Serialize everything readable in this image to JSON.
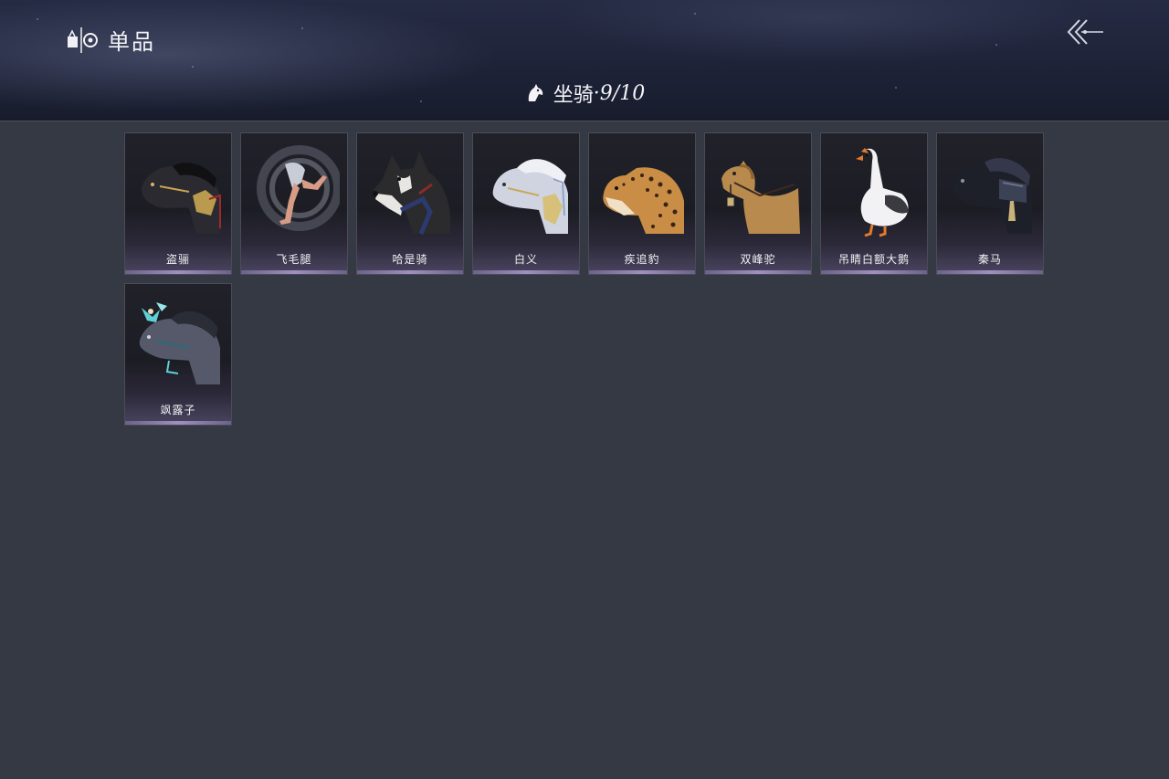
{
  "header": {
    "title": "单品",
    "title_icon": "tag-emblem-icon",
    "back_icon": "double-chevron-left-icon",
    "subtitle_label": "坐骑",
    "subtitle_count": "·9/10",
    "subtitle_icon": "horse-head-icon"
  },
  "mounts": [
    {
      "name": "盗骊",
      "icon": "armored-black-horse-icon"
    },
    {
      "name": "飞毛腿",
      "icon": "running-legs-icon"
    },
    {
      "name": "哈是骑",
      "icon": "husky-dog-icon"
    },
    {
      "name": "白义",
      "icon": "white-horse-icon"
    },
    {
      "name": "疾追豹",
      "icon": "leopard-icon"
    },
    {
      "name": "双峰驼",
      "icon": "camel-icon"
    },
    {
      "name": "吊睛白额大鹅",
      "icon": "goose-icon"
    },
    {
      "name": "秦马",
      "icon": "dark-armored-horse-icon"
    },
    {
      "name": "飒露子",
      "icon": "jeweled-grey-horse-icon"
    }
  ],
  "colors": {
    "background": "#353944",
    "header": "#1d2237",
    "card": "#1c1d24",
    "card_accent": "#a08fc0",
    "text": "#f1f1f4"
  }
}
